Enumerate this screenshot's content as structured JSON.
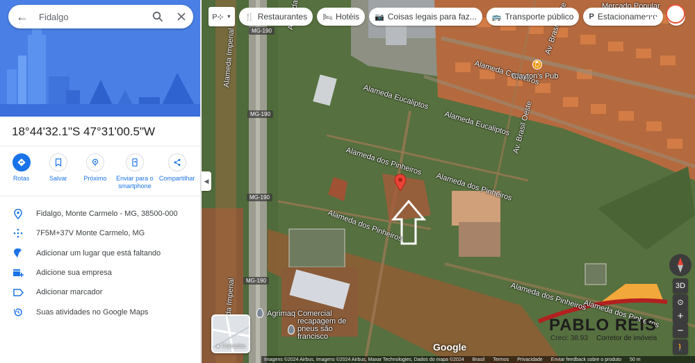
{
  "search": {
    "value": "Fidalgo"
  },
  "place": {
    "coordinates": "18°44'32.1\"S 47°31'00.5\"W"
  },
  "actions": [
    {
      "label": "Rotas"
    },
    {
      "label": "Salvar"
    },
    {
      "label": "Próximo"
    },
    {
      "label": "Enviar para o smartphone"
    },
    {
      "label": "Compartilhar"
    }
  ],
  "details": [
    {
      "icon": "location-pin-icon",
      "text": "Fidalgo, Monte Carmelo - MG, 38500-000"
    },
    {
      "icon": "plus-code-icon",
      "text": "7F5M+37V Monte Carmelo, MG"
    },
    {
      "icon": "add-place-icon",
      "text": "Adicionar um lugar que está faltando"
    },
    {
      "icon": "add-business-icon",
      "text": "Adicione sua empresa"
    },
    {
      "icon": "label-icon",
      "text": "Adicionar marcador"
    },
    {
      "icon": "history-icon",
      "text": "Suas atividades no Google Maps"
    }
  ],
  "chips": [
    {
      "icon": "restaurant-icon",
      "label": "Restaurantes"
    },
    {
      "icon": "hotel-icon",
      "label": "Hotéis"
    },
    {
      "icon": "camera-icon",
      "label": "Coisas legais para faz..."
    },
    {
      "icon": "transit-icon",
      "label": "Transporte público"
    },
    {
      "icon": "parking-icon",
      "label": "Estacionamento"
    }
  ],
  "map_labels": {
    "alameda_eucaliptos_1": "Alameda Eucaliptos",
    "alameda_eucaliptos_2": "Alameda Eucaliptos",
    "alameda_coqueiros": "Alameda Coqueiros",
    "alameda_pinheiros_1": "Alameda dos Pinheiros",
    "alameda_pinheiros_2": "Alameda dos Pinheiros",
    "alameda_pinheiros_3": "Alameda dos Pinheiros",
    "alameda_pinheiros_4": "Alameda dos Pinheiros",
    "alameda_pinheiros_5": "Alameda dos Pinheiros",
    "alameda_imperial": "Alameda Imperial",
    "av_brasil_oeste": "Av. Brasil Oeste",
    "clayton_pub": "Clayton's Pub",
    "mercado_popular": "Mercado Popular",
    "agrimaq_comercial": "Agrimaq Comercial",
    "recapagem": "recapagem de pneus são francisco",
    "highway_1": "MG-190",
    "highway_2": "MG-190",
    "highway_3": "MG-190",
    "highway_4": "MG-190"
  },
  "controls": {
    "three_d": "3D",
    "zoom_in": "+",
    "zoom_out": "−"
  },
  "layers_label": "Camadas",
  "google_logo": "Google",
  "footer": {
    "imagery": "Imagens ©2024 Airbus, Imagens ©2024 Airbus, Maxar Technologies, Dados do mapa ©2024",
    "country": "Brasil",
    "terms": "Termos",
    "privacy": "Privacidade",
    "feedback": "Enviar feedback sobre o produto",
    "scale": "50 m"
  },
  "watermark": {
    "title": "PABLO REIS",
    "subtitle": "Corretor de imóveis",
    "creci": "Creci: 38.93"
  },
  "colors": {
    "accent": "#1a73e8",
    "hero": "#4a7fe5",
    "pin": "#ea4335",
    "roof": "#e08a4e"
  }
}
